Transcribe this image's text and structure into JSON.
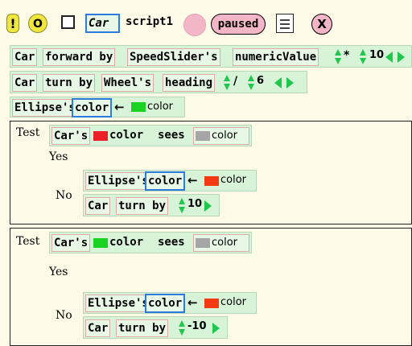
{
  "header": {
    "bang_label": "!",
    "ok_label": "O",
    "player_name": "Car",
    "script_name": "script1",
    "status_label": "paused",
    "close_label": "X"
  },
  "line1": {
    "player": "Car",
    "command": "forward by",
    "source": "SpeedSlider's",
    "property": "numericValue",
    "op": "*",
    "amount": "10"
  },
  "line2": {
    "player": "Car",
    "command": "turn by",
    "source": "Wheel's",
    "property": "heading",
    "op": "/",
    "amount": "6"
  },
  "line3": {
    "player": "Ellipse's",
    "property": "color",
    "assign": "←",
    "value_label": "color"
  },
  "test1": {
    "test_label": "Test",
    "player": "Car's",
    "swatch_label": "color",
    "sees": "sees",
    "value_label": "color",
    "yes_label": "Yes",
    "no_label": "No",
    "no_line1": {
      "player": "Ellipse's",
      "property": "color",
      "assign": "←",
      "value_label": "color"
    },
    "no_line2": {
      "player": "Car",
      "command": "turn by",
      "amount": "10"
    }
  },
  "test2": {
    "test_label": "Test",
    "player": "Car's",
    "swatch_label": "color",
    "sees": "sees",
    "value_label": "color",
    "yes_label": "Yes",
    "no_label": "No",
    "no_line1": {
      "player": "Ellipse's",
      "property": "color",
      "assign": "←",
      "value_label": "color"
    },
    "no_line2": {
      "player": "Car",
      "command": "turn by",
      "amount": "-10"
    }
  },
  "colors": {
    "tile_bg": "#e8f8e6",
    "tile_border": "#e0aaa6",
    "row_bg": "#d8f4d8",
    "script_bg": "#fdfbe7",
    "selected_border": "#2d7bdc",
    "green_swatch": "#19d222",
    "red_swatch": "#ec2027",
    "orange_swatch": "#f43a13",
    "gray_swatch": "#a6a6a6",
    "status_pink": "#f2b6c8",
    "button_yellow": "#f0e640"
  },
  "icons": [
    "warning-icon",
    "ok-icon",
    "checkbox-icon",
    "paused-icon",
    "script-menu-icon",
    "close-icon",
    "up-down-arrow-icon",
    "left-right-arrow-icon"
  ]
}
